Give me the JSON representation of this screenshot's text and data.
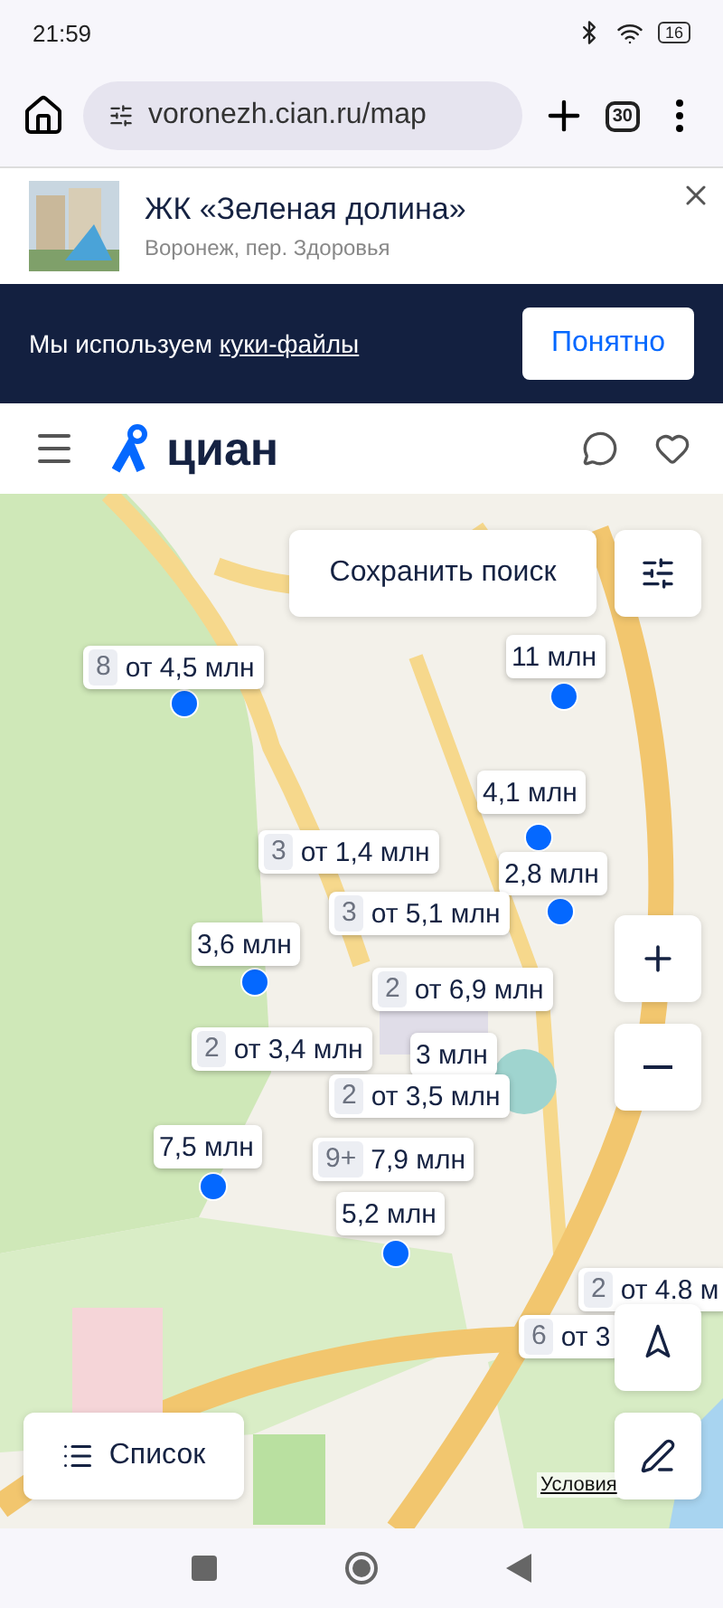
{
  "status_bar": {
    "time": "21:59",
    "battery": "16"
  },
  "browser": {
    "url": "voronezh.cian.ru/map",
    "tab_count": "30"
  },
  "banner": {
    "title": "ЖК «Зеленая долина»",
    "subtitle": "Воронеж, пер. Здоровья"
  },
  "cookie_notice": {
    "text": "Мы используем ",
    "link": "куки-файлы",
    "button": "Понятно"
  },
  "header": {
    "logo": "циан"
  },
  "map": {
    "save_search": "Сохранить поиск",
    "list_button": "Список",
    "terms_link": "Условия",
    "markers": [
      {
        "count": "8",
        "price": "от 4,5 млн"
      },
      {
        "price": "11 млн"
      },
      {
        "price": "4,1 млн"
      },
      {
        "count": "3",
        "price": "от 1,4 млн"
      },
      {
        "price": "2,8 млн"
      },
      {
        "count": "3",
        "price": "от 5,1 млн"
      },
      {
        "price": "3,6 млн"
      },
      {
        "count": "2",
        "price": "от 6,9 млн"
      },
      {
        "count": "2",
        "price": "от 3,4 млн"
      },
      {
        "price": "3 млн"
      },
      {
        "count": "2",
        "price": "от 3,5 млн"
      },
      {
        "price": "7,5 млн"
      },
      {
        "count": "9+",
        "price": "7,9 млн"
      },
      {
        "price": "5,2 млн"
      },
      {
        "count": "2",
        "price": "от 4.8 м"
      },
      {
        "count": "6",
        "price": "от 3"
      }
    ]
  }
}
